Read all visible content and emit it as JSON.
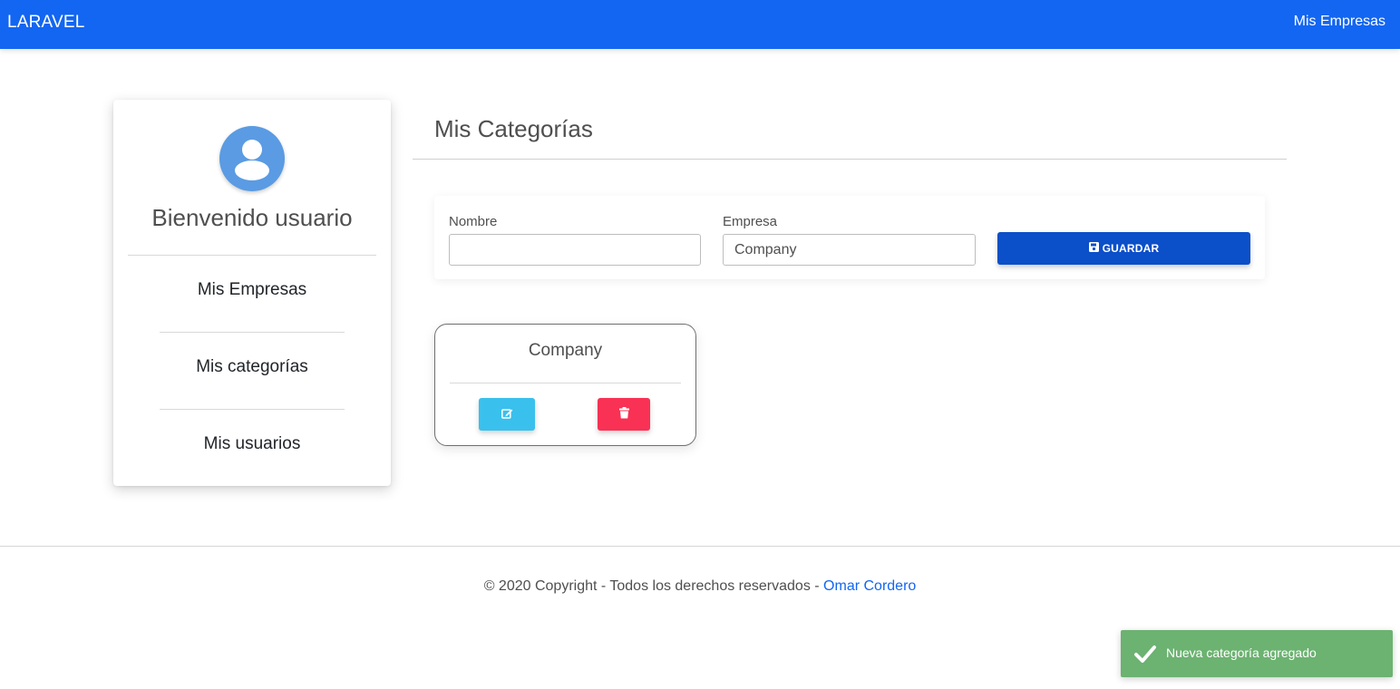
{
  "navbar": {
    "brand": "LARAVEL",
    "link": "Mis Empresas",
    "color": "#1266f1"
  },
  "sidebar": {
    "avatar_icon": "user-icon",
    "welcome": "Bienvenido usuario",
    "items": [
      {
        "label": "Mis Empresas"
      },
      {
        "label": "Mis categorías"
      },
      {
        "label": "Mis usuarios"
      }
    ]
  },
  "main": {
    "title": "Mis Categorías",
    "form": {
      "name_label": "Nombre",
      "name_value": "",
      "company_label": "Empresa",
      "company_value": "Company",
      "save_icon": "floppy-disk-icon",
      "save_label": "Guardar"
    },
    "categories": [
      {
        "name": "Company",
        "edit_icon": "edit-icon",
        "delete_icon": "trash-icon"
      }
    ]
  },
  "footer": {
    "text": "© 2020 Copyright - Todos los derechos reservados - ",
    "author": "Omar Cordero"
  },
  "toast": {
    "icon": "check-icon",
    "message": "Nueva categoría agregado",
    "color": "#6cb271"
  }
}
